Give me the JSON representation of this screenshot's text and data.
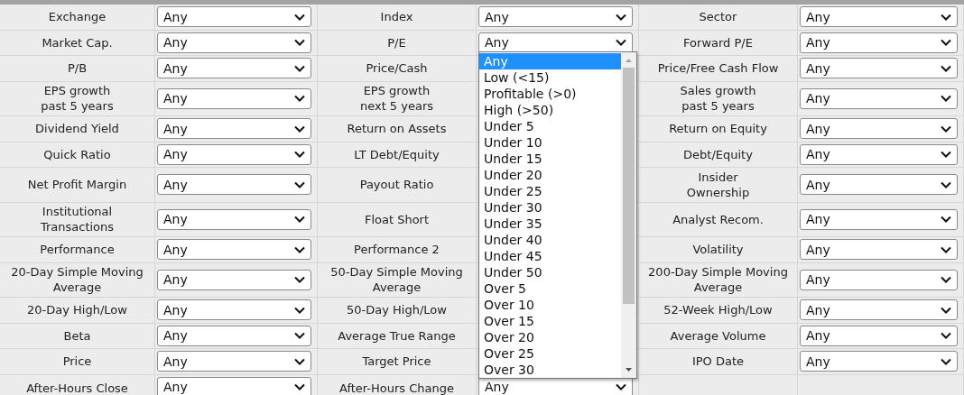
{
  "rows": [
    {
      "cells": [
        {
          "label": "Exchange",
          "value": "Any"
        },
        {
          "label": "Index",
          "value": "Any"
        },
        {
          "label": "Sector",
          "value": "Any"
        }
      ]
    },
    {
      "cells": [
        {
          "label": "Market Cap.",
          "value": "Any"
        },
        {
          "label": "P/E",
          "value": "Any"
        },
        {
          "label": "Forward P/E",
          "value": "Any"
        }
      ]
    },
    {
      "cells": [
        {
          "label": "P/B",
          "value": "Any"
        },
        {
          "label": "Price/Cash"
        },
        {
          "label": "Price/Free Cash Flow",
          "value": "Any"
        }
      ]
    },
    {
      "cells": [
        {
          "label": "EPS growth\npast 5 years",
          "value": "Any"
        },
        {
          "label": "EPS growth\nnext 5 years"
        },
        {
          "label": "Sales growth\npast 5 years",
          "value": "Any"
        }
      ]
    },
    {
      "cells": [
        {
          "label": "Dividend Yield",
          "value": "Any"
        },
        {
          "label": "Return on Assets"
        },
        {
          "label": "Return on Equity",
          "value": "Any"
        }
      ]
    },
    {
      "cells": [
        {
          "label": "Quick Ratio",
          "value": "Any"
        },
        {
          "label": "LT Debt/Equity"
        },
        {
          "label": "Debt/Equity",
          "value": "Any"
        }
      ]
    },
    {
      "cells": [
        {
          "label": "Net Profit Margin",
          "value": "Any"
        },
        {
          "label": "Payout Ratio"
        },
        {
          "label": "Insider\nOwnership",
          "value": "Any"
        }
      ]
    },
    {
      "cells": [
        {
          "label": "Institutional\nTransactions",
          "value": "Any"
        },
        {
          "label": "Float Short"
        },
        {
          "label": "Analyst Recom.",
          "value": "Any"
        }
      ]
    },
    {
      "cells": [
        {
          "label": "Performance",
          "value": "Any"
        },
        {
          "label": "Performance 2"
        },
        {
          "label": "Volatility",
          "value": "Any"
        }
      ]
    },
    {
      "cells": [
        {
          "label": "20-Day Simple Moving\nAverage",
          "value": "Any"
        },
        {
          "label": "50-Day Simple Moving\nAverage"
        },
        {
          "label": "200-Day Simple Moving\nAverage",
          "value": "Any"
        }
      ]
    },
    {
      "cells": [
        {
          "label": "20-Day High/Low",
          "value": "Any"
        },
        {
          "label": "50-Day High/Low"
        },
        {
          "label": "52-Week High/Low",
          "value": "Any"
        }
      ]
    },
    {
      "cells": [
        {
          "label": "Beta",
          "value": "Any"
        },
        {
          "label": "Average True Range"
        },
        {
          "label": "Average Volume",
          "value": "Any"
        }
      ]
    },
    {
      "cells": [
        {
          "label": "Price",
          "value": "Any"
        },
        {
          "label": "Target Price"
        },
        {
          "label": "IPO Date",
          "value": "Any"
        }
      ]
    },
    {
      "cells": [
        {
          "label": "After-Hours Close",
          "value": "Any"
        },
        {
          "label": "After-Hours Change",
          "value": "Any"
        },
        {}
      ]
    }
  ],
  "open_list": {
    "options": [
      {
        "label": "Any",
        "selected": true
      },
      {
        "label": "Low (<15)",
        "selected": false
      },
      {
        "label": "Profitable (>0)",
        "selected": false
      },
      {
        "label": "High (>50)",
        "selected": false
      },
      {
        "label": "Under 5",
        "selected": false
      },
      {
        "label": "Under 10",
        "selected": false
      },
      {
        "label": "Under 15",
        "selected": false
      },
      {
        "label": "Under 20",
        "selected": false
      },
      {
        "label": "Under 25",
        "selected": false
      },
      {
        "label": "Under 30",
        "selected": false
      },
      {
        "label": "Under 35",
        "selected": false
      },
      {
        "label": "Under 40",
        "selected": false
      },
      {
        "label": "Under 45",
        "selected": false
      },
      {
        "label": "Under 50",
        "selected": false
      },
      {
        "label": "Over 5",
        "selected": false
      },
      {
        "label": "Over 10",
        "selected": false
      },
      {
        "label": "Over 15",
        "selected": false
      },
      {
        "label": "Over 20",
        "selected": false
      },
      {
        "label": "Over 25",
        "selected": false
      },
      {
        "label": "Over 30",
        "selected": false
      }
    ]
  }
}
